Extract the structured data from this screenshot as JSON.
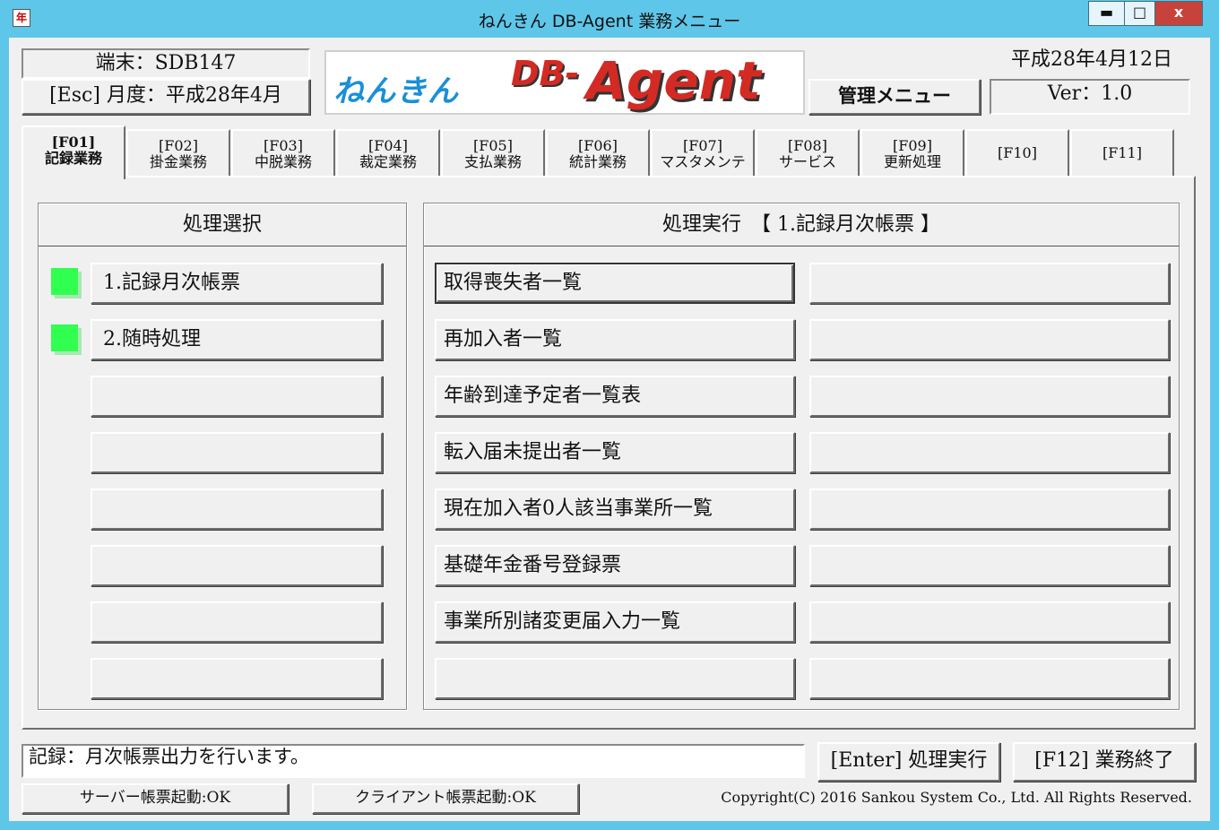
{
  "window": {
    "title": "ねんきん DB-Agent 業務メニュー",
    "app_icon": "年",
    "min_label": "▬",
    "max_label": "□",
    "close_label": "x"
  },
  "header": {
    "terminal": "端末：SDB147",
    "month": "[Esc] 月度：平成28年4月",
    "logo_kana": "ねんきん",
    "logo_db": "DB-",
    "logo_agent": "Agent",
    "admin_menu": "管理メニュー",
    "date": "平成28年4月12日",
    "version": "Ver：1.0"
  },
  "tabs": [
    {
      "key": "[F01]",
      "name": "記録業務",
      "active": true
    },
    {
      "key": "[F02]",
      "name": "掛金業務"
    },
    {
      "key": "[F03]",
      "name": "中脱業務"
    },
    {
      "key": "[F04]",
      "name": "裁定業務"
    },
    {
      "key": "[F05]",
      "name": "支払業務"
    },
    {
      "key": "[F06]",
      "name": "統計業務"
    },
    {
      "key": "[F07]",
      "name": "マスタメンテ"
    },
    {
      "key": "[F08]",
      "name": "サービス"
    },
    {
      "key": "[F09]",
      "name": "更新処理"
    },
    {
      "key": "[F10]",
      "name": ""
    },
    {
      "key": "[F11]",
      "name": ""
    }
  ],
  "select_panel": {
    "heading": "処理選択",
    "items": [
      {
        "label": "1.記録月次帳票",
        "indicator": true
      },
      {
        "label": "2.随時処理",
        "indicator": true
      },
      {
        "label": ""
      },
      {
        "label": ""
      },
      {
        "label": ""
      },
      {
        "label": ""
      },
      {
        "label": ""
      },
      {
        "label": ""
      }
    ]
  },
  "exec_panel": {
    "heading": "処理実行　【 1.記録月次帳票 】",
    "left": [
      "取得喪失者一覧",
      "再加入者一覧",
      "年齢到達予定者一覧表",
      "転入届未提出者一覧",
      "現在加入者0人該当事業所一覧",
      "基礎年金番号登録票",
      "事業所別諸変更届入力一覧",
      ""
    ],
    "right": [
      "",
      "",
      "",
      "",
      "",
      "",
      "",
      ""
    ]
  },
  "footer": {
    "message": "記録：月次帳票出力を行います。",
    "enter_button": "[Enter] 処理実行",
    "f12_button": "[F12] 業務終了",
    "server_status": "サーバー帳票起動:OK",
    "client_status": "クライアント帳票起動:OK",
    "copyright": "Copyright(C) 2016 Sankou System Co., Ltd. All Rights Reserved."
  },
  "colors": {
    "title_bar": "#5ec6e9",
    "indicator_green": "#30ff50",
    "close_button": "#c7423a",
    "logo_blue": "#1a8fd8",
    "logo_red": "#d42a24"
  }
}
